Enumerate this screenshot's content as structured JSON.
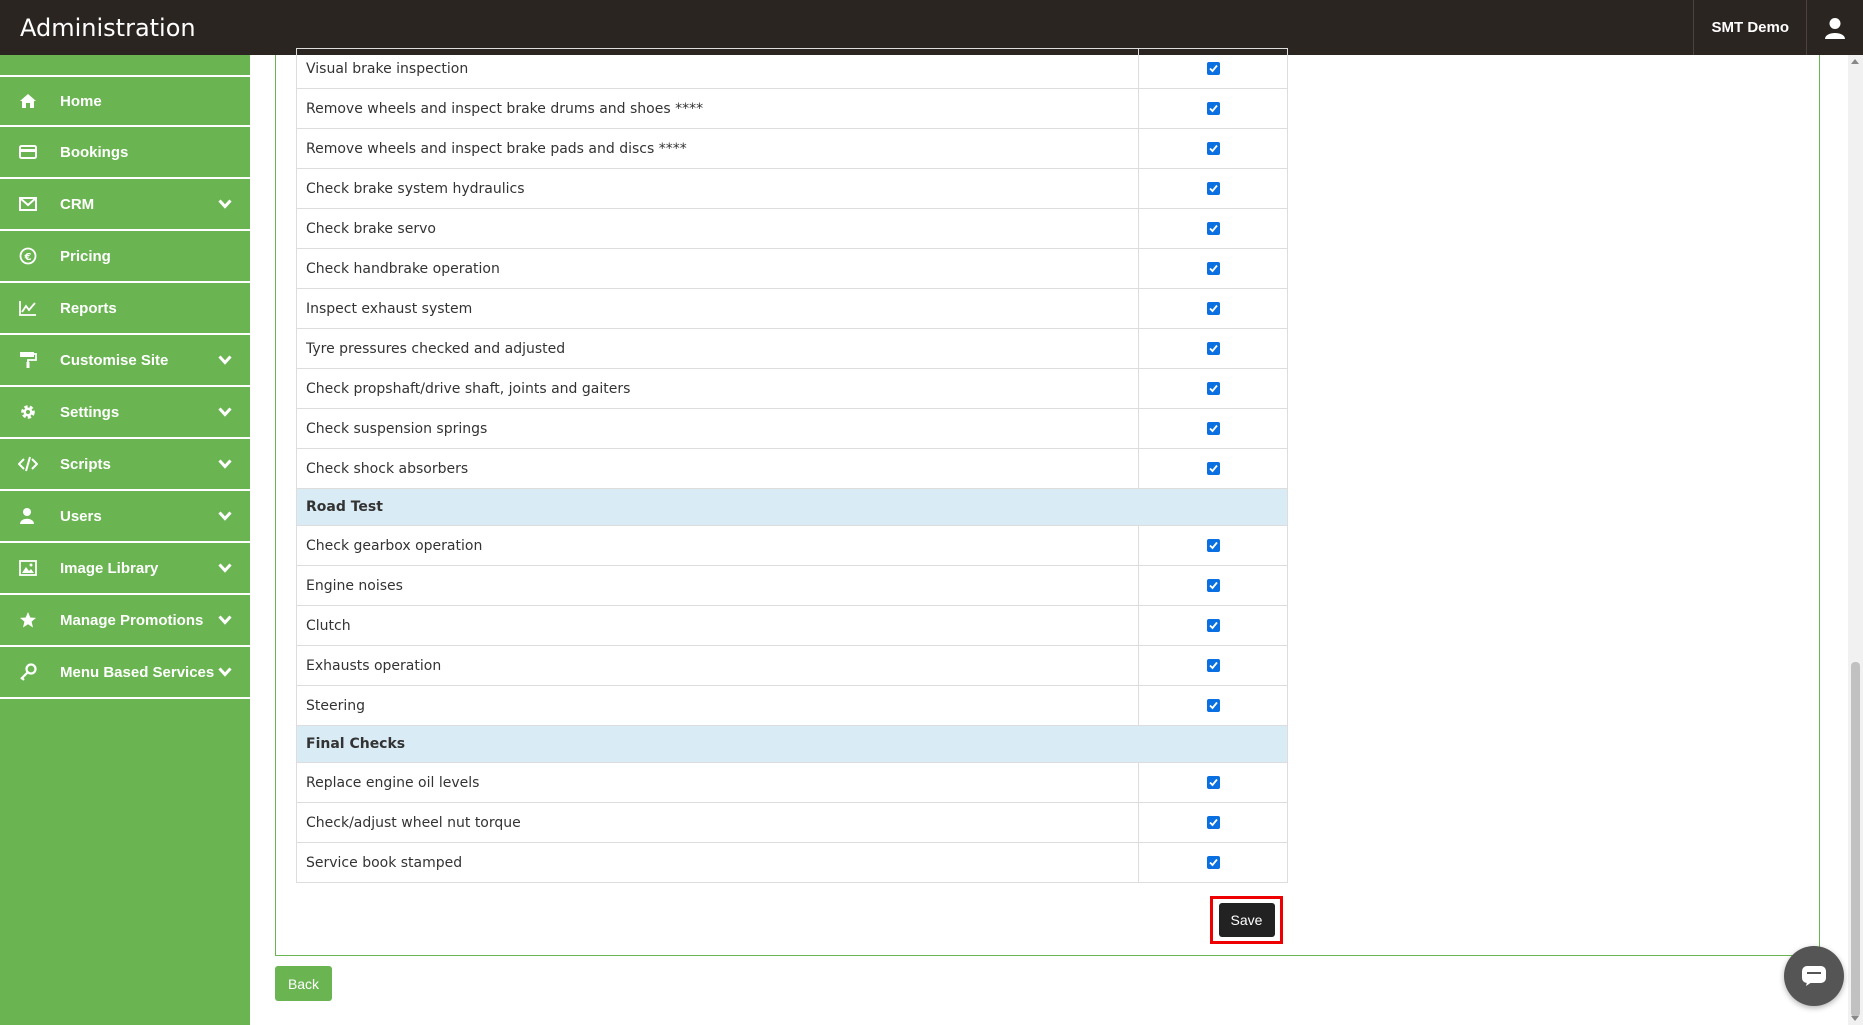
{
  "header": {
    "title": "Administration",
    "user_name": "SMT Demo"
  },
  "sidebar": {
    "items": [
      {
        "label": "Home",
        "icon": "home-icon",
        "has_submenu": false
      },
      {
        "label": "Bookings",
        "icon": "credit-card-icon",
        "has_submenu": false
      },
      {
        "label": "CRM",
        "icon": "envelope-icon",
        "has_submenu": true
      },
      {
        "label": "Pricing",
        "icon": "euro-icon",
        "has_submenu": false
      },
      {
        "label": "Reports",
        "icon": "line-chart-icon",
        "has_submenu": false
      },
      {
        "label": "Customise Site",
        "icon": "paint-roller-icon",
        "has_submenu": true
      },
      {
        "label": "Settings",
        "icon": "gear-icon",
        "has_submenu": true
      },
      {
        "label": "Scripts",
        "icon": "code-icon",
        "has_submenu": true
      },
      {
        "label": "Users",
        "icon": "user-icon",
        "has_submenu": true
      },
      {
        "label": "Image Library",
        "icon": "image-icon",
        "has_submenu": true
      },
      {
        "label": "Manage Promotions",
        "icon": "star-icon",
        "has_submenu": true
      },
      {
        "label": "Menu Based Services",
        "icon": "key-icon",
        "has_submenu": true
      }
    ]
  },
  "checklist": {
    "rows": [
      {
        "type": "item",
        "label": "Visual brake inspection",
        "checked": true
      },
      {
        "type": "item",
        "label": "Remove wheels and inspect brake drums and shoes ****",
        "checked": true
      },
      {
        "type": "item",
        "label": "Remove wheels and inspect brake pads and discs ****",
        "checked": true
      },
      {
        "type": "item",
        "label": "Check brake system hydraulics",
        "checked": true
      },
      {
        "type": "item",
        "label": "Check brake servo",
        "checked": true
      },
      {
        "type": "item",
        "label": "Check handbrake operation",
        "checked": true
      },
      {
        "type": "item",
        "label": "Inspect exhaust system",
        "checked": true
      },
      {
        "type": "item",
        "label": "Tyre pressures checked and adjusted",
        "checked": true
      },
      {
        "type": "item",
        "label": "Check propshaft/drive shaft, joints and gaiters",
        "checked": true
      },
      {
        "type": "item",
        "label": "Check suspension springs",
        "checked": true
      },
      {
        "type": "item",
        "label": "Check shock absorbers",
        "checked": true
      },
      {
        "type": "section",
        "label": "Road Test"
      },
      {
        "type": "item",
        "label": "Check gearbox operation",
        "checked": true
      },
      {
        "type": "item",
        "label": "Engine noises",
        "checked": true
      },
      {
        "type": "item",
        "label": "Clutch",
        "checked": true
      },
      {
        "type": "item",
        "label": "Exhausts operation",
        "checked": true
      },
      {
        "type": "item",
        "label": "Steering",
        "checked": true
      },
      {
        "type": "section",
        "label": "Final Checks"
      },
      {
        "type": "item",
        "label": "Replace engine oil levels",
        "checked": true
      },
      {
        "type": "item",
        "label": "Check/adjust wheel nut torque",
        "checked": true
      },
      {
        "type": "item",
        "label": "Service book stamped",
        "checked": true
      }
    ]
  },
  "actions": {
    "save_label": "Save",
    "back_label": "Back"
  },
  "colors": {
    "sidebar_bg": "#6ab552",
    "topbar_bg": "#2b2522",
    "section_bg": "#d9ebf5",
    "checkbox": "#0a6fe0",
    "highlight": "#ee0000"
  }
}
